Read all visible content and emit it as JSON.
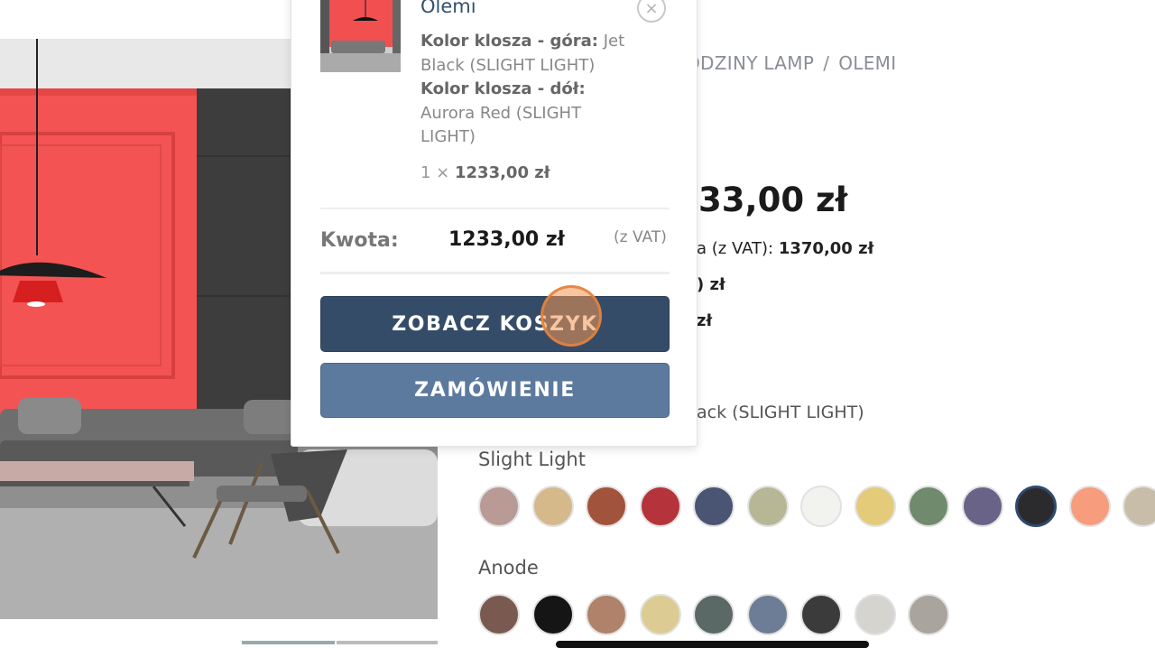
{
  "breadcrumb": {
    "partial": "ODZINY LAMP",
    "separator": "/",
    "current": "OLEMI"
  },
  "product": {
    "price_partial": ".33,00 zł",
    "price_line_1_prefix": "a (z VAT):",
    "price_line_1_value": "1370,00 zł",
    "price_line_2": ") zł",
    "price_line_3": "zł",
    "selected_color_partial": "ack (SLIGHT LIGHT)"
  },
  "swatch_groups": [
    {
      "label": "Slight Light",
      "colors": [
        "#b99a94",
        "#d6b98a",
        "#a2533b",
        "#b5333a",
        "#4a5473",
        "#b7b795",
        "#f2f2ee",
        "#e4cb7a",
        "#6f8a6d",
        "#696487",
        "#2b2b2e",
        "#f79c7c",
        "#c7bda9"
      ],
      "selected_index": 10
    },
    {
      "label": "Anode",
      "colors": [
        "#7a5a50",
        "#151515",
        "#b0826a",
        "#dccc94",
        "#5a6965",
        "#6d7d95",
        "#3b3b3b",
        "#d5d4cf",
        "#aaa49e"
      ],
      "selected_index": -1
    }
  ],
  "mini_cart": {
    "item_name": "Olemi",
    "close_symbol": "×",
    "attr1_label": "Kolor klosza - góra:",
    "attr1_value": "Jet Black (SLIGHT LIGHT)",
    "attr2_label": "Kolor klosza - dół:",
    "attr2_value": "Aurora Red (SLIGHT LIGHT)",
    "qty": "1 ×",
    "item_price": "1233,00 zł",
    "total_label": "Kwota:",
    "total_value": "1233,00 zł",
    "total_vat": "(z VAT)",
    "view_cart_button": "ZOBACZ KOSZYK",
    "checkout_button": "ZAMÓWIENIE"
  }
}
